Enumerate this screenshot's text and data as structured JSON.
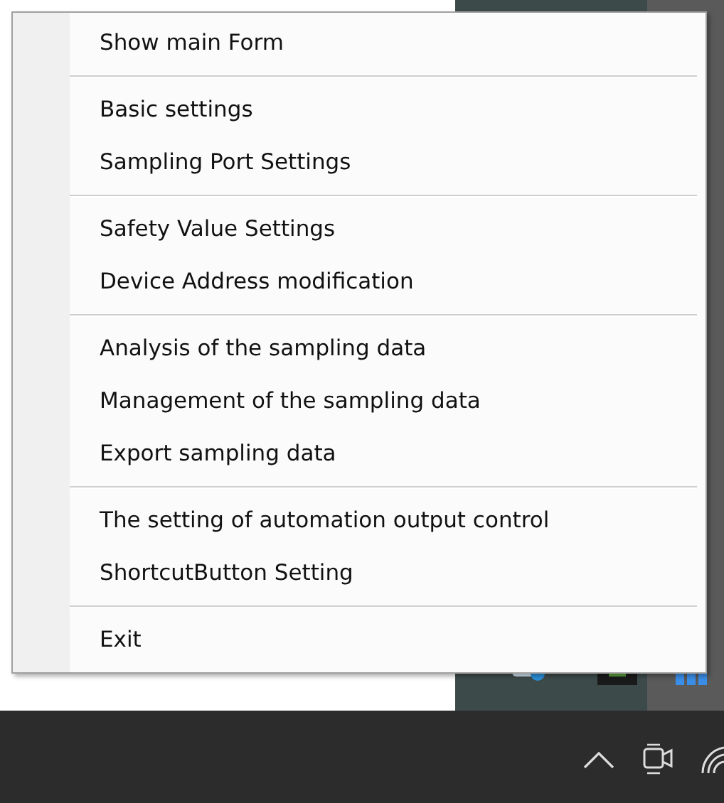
{
  "context_menu": {
    "groups": [
      {
        "items": [
          {
            "label": "Show main Form"
          }
        ]
      },
      {
        "items": [
          {
            "label": "Basic settings"
          },
          {
            "label": "Sampling Port Settings"
          }
        ]
      },
      {
        "items": [
          {
            "label": "Safety Value Settings"
          },
          {
            "label": "Device Address modification"
          }
        ]
      },
      {
        "items": [
          {
            "label": "Analysis of the sampling data"
          },
          {
            "label": "Management of the sampling data"
          },
          {
            "label": "Export sampling data"
          }
        ]
      },
      {
        "items": [
          {
            "label": "The setting of automation output control"
          },
          {
            "label": "ShortcutButton Setting"
          }
        ]
      },
      {
        "items": [
          {
            "label": "Exit"
          }
        ]
      }
    ]
  }
}
